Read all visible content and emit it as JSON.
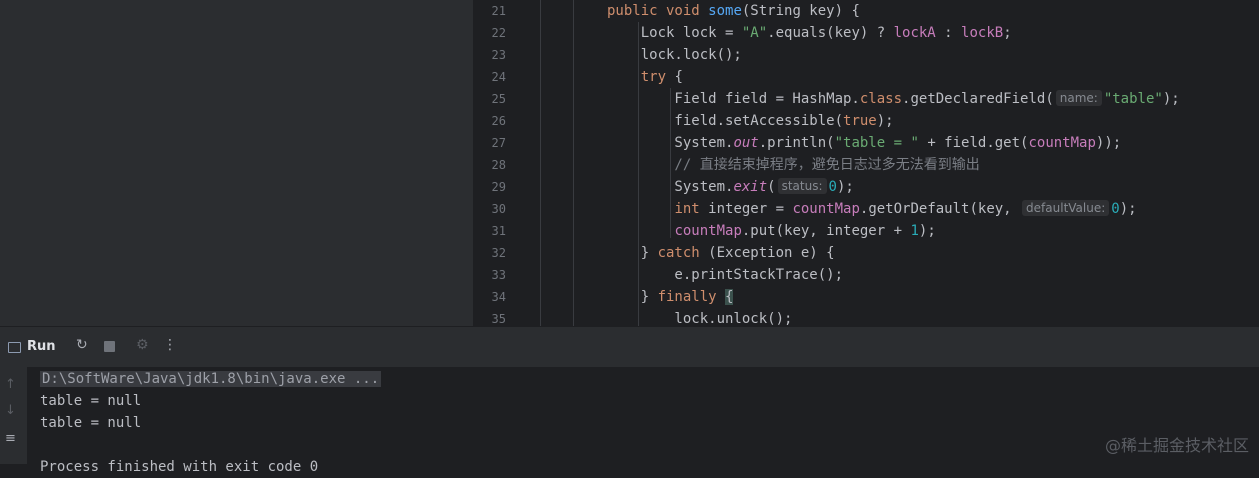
{
  "editor": {
    "line_numbers": [
      "21",
      "22",
      "23",
      "24",
      "25",
      "26",
      "27",
      "28",
      "29",
      "30",
      "31",
      "32",
      "33",
      "34",
      "35"
    ],
    "lines": [
      [
        {
          "t": "public void ",
          "c": "kw"
        },
        {
          "t": "some",
          "c": "fn"
        },
        {
          "t": "(String key) {",
          "c": ""
        }
      ],
      [
        {
          "t": "    Lock lock = ",
          "c": ""
        },
        {
          "t": "\"A\"",
          "c": "str"
        },
        {
          "t": ".equals(key) ? ",
          "c": ""
        },
        {
          "t": "lockA",
          "c": "fld"
        },
        {
          "t": " : ",
          "c": ""
        },
        {
          "t": "lockB",
          "c": "fld"
        },
        {
          "t": ";",
          "c": ""
        }
      ],
      [
        {
          "t": "    lock.lock();",
          "c": ""
        }
      ],
      [
        {
          "t": "    ",
          "c": ""
        },
        {
          "t": "try",
          "c": "kw"
        },
        {
          "t": " {",
          "c": ""
        }
      ],
      [
        {
          "t": "        Field field = HashMap.",
          "c": ""
        },
        {
          "t": "class",
          "c": "kw"
        },
        {
          "t": ".getDeclaredField(",
          "c": ""
        },
        {
          "h": "name:"
        },
        {
          "t": "\"table\"",
          "c": "str"
        },
        {
          "t": ");",
          "c": ""
        }
      ],
      [
        {
          "t": "        field.setAccessible(",
          "c": ""
        },
        {
          "t": "true",
          "c": "kw"
        },
        {
          "t": ");",
          "c": ""
        }
      ],
      [
        {
          "t": "        System.",
          "c": ""
        },
        {
          "t": "out",
          "c": "ital"
        },
        {
          "t": ".println(",
          "c": ""
        },
        {
          "t": "\"table = \"",
          "c": "str"
        },
        {
          "t": " + field.get(",
          "c": ""
        },
        {
          "t": "countMap",
          "c": "fld"
        },
        {
          "t": "));",
          "c": ""
        }
      ],
      [
        {
          "t": "        // 直接结束掉程序，避免日志过多无法看到输出",
          "c": "cmt"
        }
      ],
      [
        {
          "t": "        System.",
          "c": ""
        },
        {
          "t": "exit",
          "c": "ital"
        },
        {
          "t": "(",
          "c": ""
        },
        {
          "h": "status:"
        },
        {
          "t": "0",
          "c": "num"
        },
        {
          "t": ");",
          "c": ""
        }
      ],
      [
        {
          "t": "        ",
          "c": ""
        },
        {
          "t": "int",
          "c": "kw"
        },
        {
          "t": " integer = ",
          "c": ""
        },
        {
          "t": "countMap",
          "c": "fld"
        },
        {
          "t": ".getOrDefault(key, ",
          "c": ""
        },
        {
          "h": "defaultValue:"
        },
        {
          "t": "0",
          "c": "num"
        },
        {
          "t": ");",
          "c": ""
        }
      ],
      [
        {
          "t": "        ",
          "c": ""
        },
        {
          "t": "countMap",
          "c": "fld"
        },
        {
          "t": ".put(key, integer + ",
          "c": ""
        },
        {
          "t": "1",
          "c": "num"
        },
        {
          "t": ");",
          "c": ""
        }
      ],
      [
        {
          "t": "    } ",
          "c": ""
        },
        {
          "t": "catch",
          "c": "kw"
        },
        {
          "t": " (Exception e) {",
          "c": ""
        }
      ],
      [
        {
          "t": "        e.printStackTrace();",
          "c": ""
        }
      ],
      [
        {
          "t": "    } ",
          "c": ""
        },
        {
          "t": "finally",
          "c": "kw"
        },
        {
          "t": " ",
          "c": ""
        },
        {
          "t": "{",
          "c": "brace-hl"
        }
      ],
      [
        {
          "t": "        lock.unlock();",
          "c": ""
        }
      ]
    ]
  },
  "run_panel": {
    "title": "Run",
    "icons": [
      "rerun-icon",
      "stop-icon",
      "debug-icon",
      "more-icon"
    ]
  },
  "console": {
    "command": "D:\\SoftWare\\Java\\jdk1.8\\bin\\java.exe ...",
    "output": [
      "table = null",
      "table = null"
    ],
    "partial_line": "Process finished with exit code 0"
  },
  "watermark": "@稀土掘金技术社区"
}
